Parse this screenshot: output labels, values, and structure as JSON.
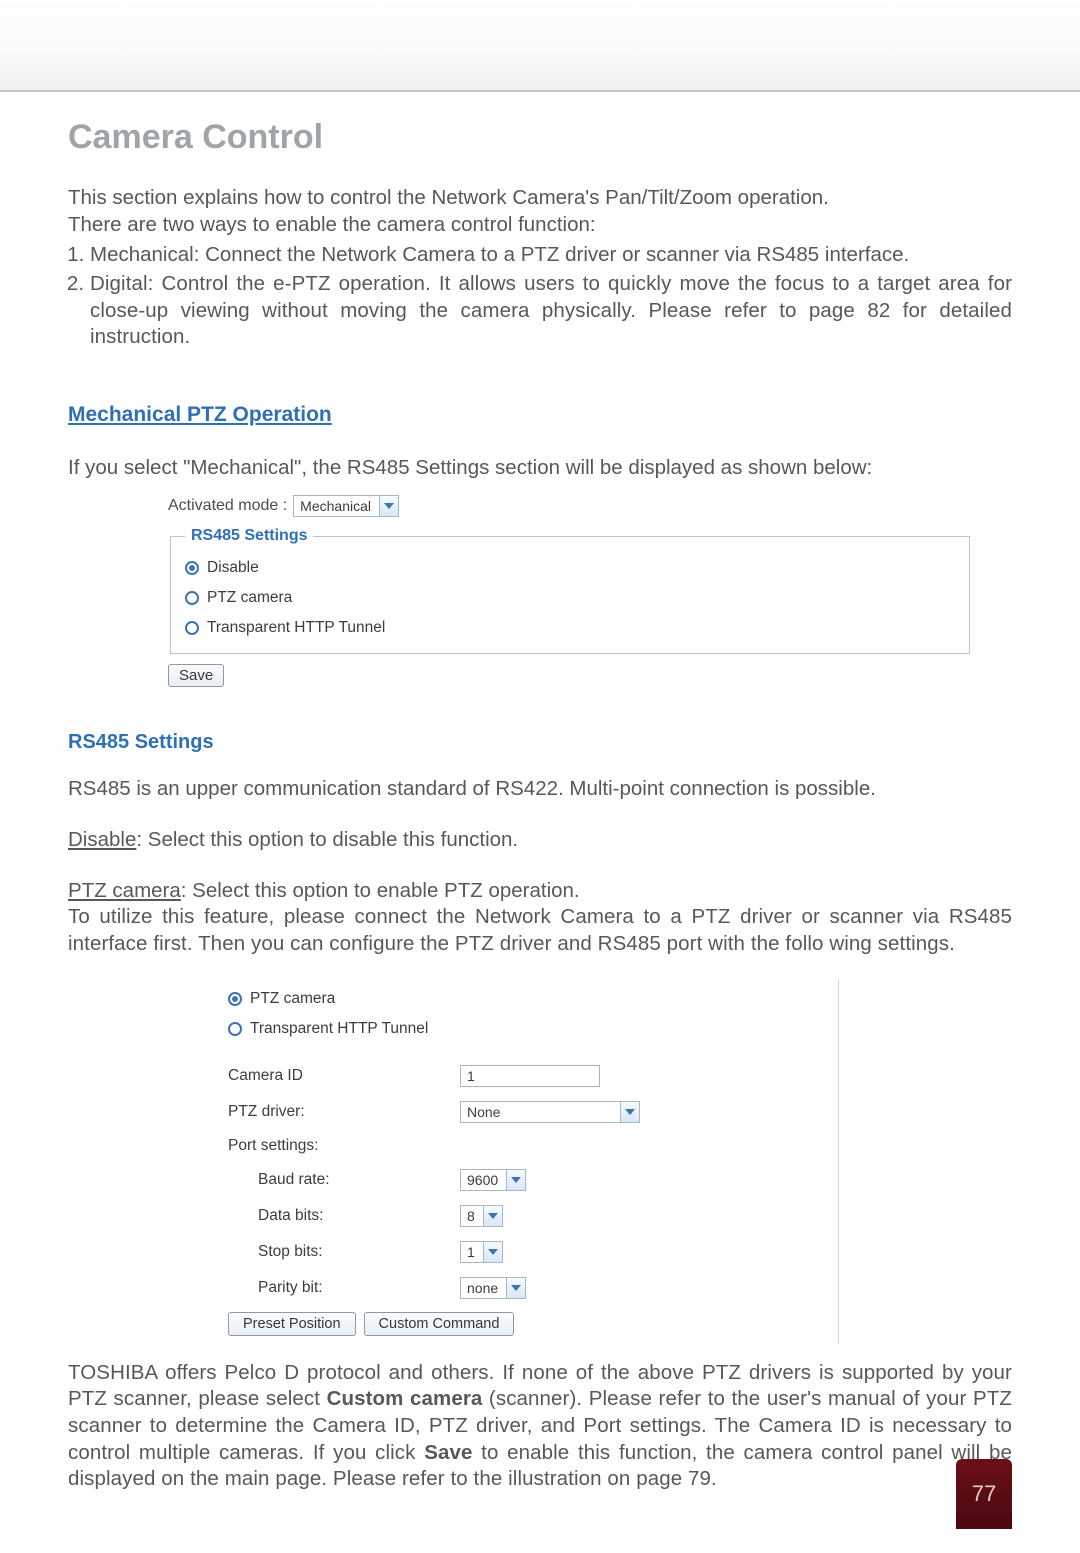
{
  "page_number": "77",
  "title": "Camera Control",
  "intro": [
    "This section explains how to control the Network Camera's Pan/Tilt/Zoom operation.",
    "There are two ways to enable the camera control function:"
  ],
  "ways": [
    "Mechanical: Connect the Network Camera to a PTZ driver or scanner via RS485 interface.",
    "Digital: Control the e-PTZ operation. It allows users to quickly move the focus to a target area for close-up viewing without moving the camera physically. Please refer to page 82 for detailed instruction."
  ],
  "section_link": "Mechanical PTZ Operation",
  "mech_intro": "If you select \"Mechanical\", the RS485 Settings section will be displayed as shown below:",
  "panel1": {
    "activated_label": "Activated mode :",
    "activated_value": "Mechanical",
    "legend": "RS485 Settings",
    "options": {
      "disable": "Disable",
      "ptz": "PTZ camera",
      "transparent": "Transparent HTTP Tunnel"
    },
    "save": "Save"
  },
  "rs485_heading": "RS485 Settings",
  "rs485_intro": "RS485 is an upper communication standard of RS422. Multi-point connection is possible.",
  "disable_label": "Disable",
  "disable_text": ": Select this option to disable this function.",
  "ptz_label": "PTZ camera",
  "ptz_text": ": Select this option to enable PTZ operation.",
  "ptz_para": "To utilize this feature, please connect the Network Camera to a PTZ driver or scanner via RS485 interface first. Then you can configure the PTZ driver and RS485 port with the follo wing settings.",
  "panel2": {
    "ptz": "PTZ camera",
    "transparent": "Transparent HTTP Tunnel",
    "camera_id_label": "Camera ID",
    "camera_id_value": "1",
    "ptz_driver_label": "PTZ driver:",
    "ptz_driver_value": "None",
    "port_settings_label": "Port settings:",
    "baud_rate_label": "Baud rate:",
    "baud_rate_value": "9600",
    "data_bits_label": "Data bits:",
    "data_bits_value": "8",
    "stop_bits_label": "Stop bits:",
    "stop_bits_value": "1",
    "parity_bit_label": "Parity bit:",
    "parity_bit_value": "none",
    "preset_btn": "Preset Position",
    "custom_btn": "Custom Command"
  },
  "closing_top": "TOSHIBA offers Pelco D protocol and others. If none of the above PTZ drivers is supported by your PTZ scanner, please select ",
  "closing_bold1": "Custom camera",
  "closing_mid1": " (scanner). Please refer to the user's manual of your PTZ scanner to determine the Camera ID, PTZ driver, and Port settings. The Camera ID is necessary to control multiple cameras. If you click ",
  "closing_bold2": "Save",
  "closing_end": " to enable this function, the camera control panel will be displayed on the main page. Please refer to the illustration on page 79."
}
